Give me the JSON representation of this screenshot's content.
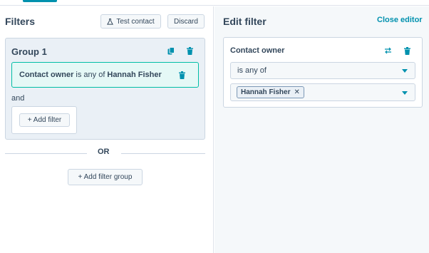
{
  "filters_panel": {
    "title": "Filters",
    "test_contact_label": "Test contact",
    "discard_label": "Discard",
    "group": {
      "title": "Group 1",
      "filter": {
        "property": "Contact owner",
        "operator": "is any of",
        "value": "Hannah Fisher"
      },
      "and_label": "and",
      "add_filter_label": "+ Add filter"
    },
    "or_label": "OR",
    "add_filter_group_label": "+ Add filter group"
  },
  "edit_panel": {
    "title": "Edit filter",
    "close_label": "Close editor",
    "property_title": "Contact owner",
    "operator_value": "is any of",
    "selected_chips": [
      "Hannah Fisher"
    ]
  },
  "colors": {
    "accent": "#0091ae",
    "filter_card_border": "#00bda5",
    "filter_card_bg": "#e5f8f6",
    "group_bg": "#eaf0f6",
    "text": "#33475b"
  },
  "icons": {
    "test_contact": "flask-icon",
    "duplicate": "copy-icon",
    "delete": "trash-icon",
    "swap": "swap-icon",
    "dropdown": "caret-down-icon",
    "remove_chip": "close-icon"
  }
}
